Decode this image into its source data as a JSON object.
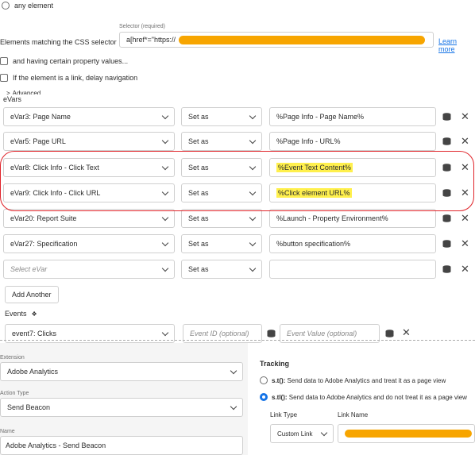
{
  "top": {
    "any_element_label": "any element",
    "selector_label": "Selector (required)",
    "css_selector_label": "Elements matching the CSS selector",
    "selector_value": "a[href*=\"https://",
    "learn_more": "Learn more",
    "property_values_label": "and having certain property values...",
    "delay_navigation_label": "If the element is a link, delay navigation",
    "advanced_label": "Advanced"
  },
  "evars": {
    "heading": "eVars",
    "rows": [
      {
        "name": "eVar3: Page Name",
        "action": "Set as",
        "value": "%Page Info - Page Name%"
      },
      {
        "name": "eVar5: Page URL",
        "action": "Set as",
        "value": "%Page Info - URL%"
      },
      {
        "name": "eVar8: Click Info - Click Text",
        "action": "Set as",
        "value": "%Event Text Content%"
      },
      {
        "name": "eVar9: Click Info - Click URL",
        "action": "Set as",
        "value": "%Click element URL%"
      },
      {
        "name": "eVar20: Report Suite",
        "action": "Set as",
        "value": "%Launch - Property Environment%"
      },
      {
        "name": "eVar27: Specification",
        "action": "Set as",
        "value": "%button specification%"
      },
      {
        "name": "Select eVar",
        "action": "Set as",
        "value": ""
      }
    ],
    "add_another": "Add Another"
  },
  "events": {
    "heading": "Events",
    "event_name": "event7: Clicks",
    "event_id_placeholder": "Event ID (optional)",
    "event_value_placeholder": "Event Value (optional)"
  },
  "lower": {
    "extension_label": "Extension",
    "extension_value": "Adobe Analytics",
    "action_type_label": "Action Type",
    "action_type_value": "Send Beacon",
    "name_label": "Name",
    "name_value": "Adobe Analytics - Send Beacon",
    "tracking_heading": "Tracking",
    "option1_fn": "s.t():",
    "option1_text": " Send data to Adobe Analytics and treat it as a page view",
    "option2_fn": "s.tl():",
    "option2_text": " Send data to Adobe Analytics and do not treat it as a page view",
    "link_type_label": "Link Type",
    "link_name_label": "Link Name",
    "link_type_value": "Custom Link"
  },
  "colors": {
    "accent": "#1473e6",
    "annotation_red": "#e0242a",
    "highlight": "#fff04d",
    "redaction": "#f7a500"
  }
}
